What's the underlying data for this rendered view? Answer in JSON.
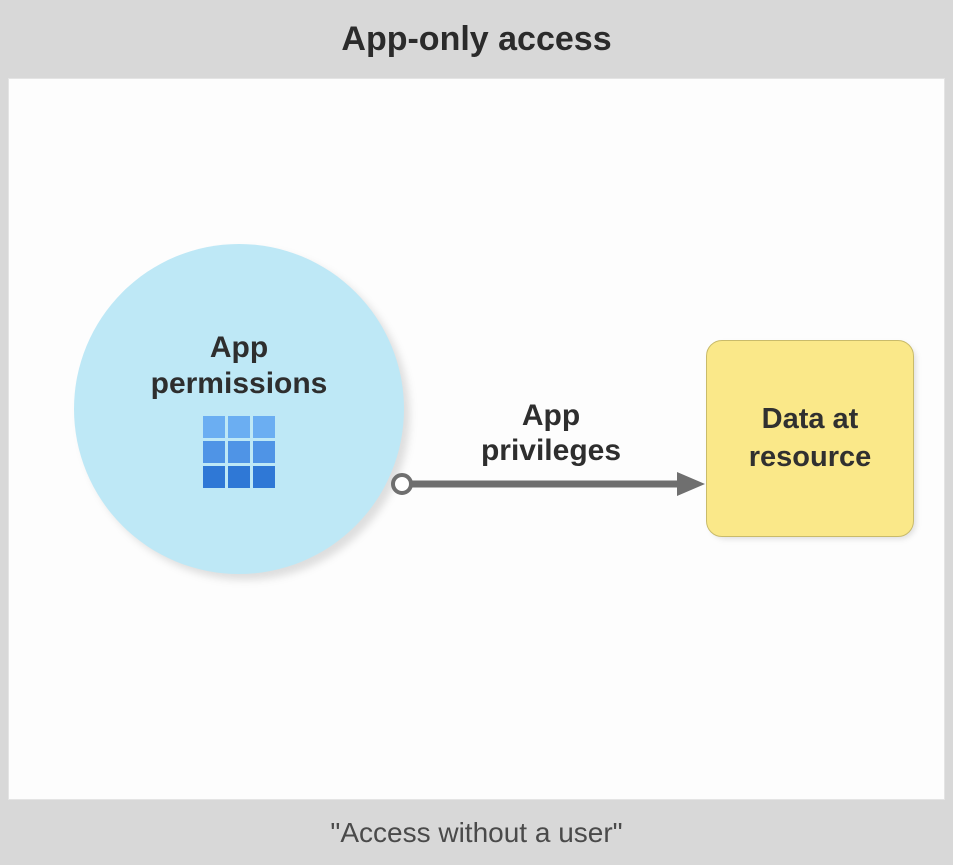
{
  "header": {
    "title": "App-only access"
  },
  "footer": {
    "caption": "\"Access without a user\""
  },
  "nodes": {
    "app": {
      "label": "App\npermissions",
      "icon": "grid-icon"
    },
    "resource": {
      "label": "Data at\nresource"
    }
  },
  "arrow": {
    "label": "App\nprivileges"
  },
  "colors": {
    "circleFill": "#bee8f6",
    "resourceFill": "#fae889",
    "arrow": "#6f6f6f"
  }
}
